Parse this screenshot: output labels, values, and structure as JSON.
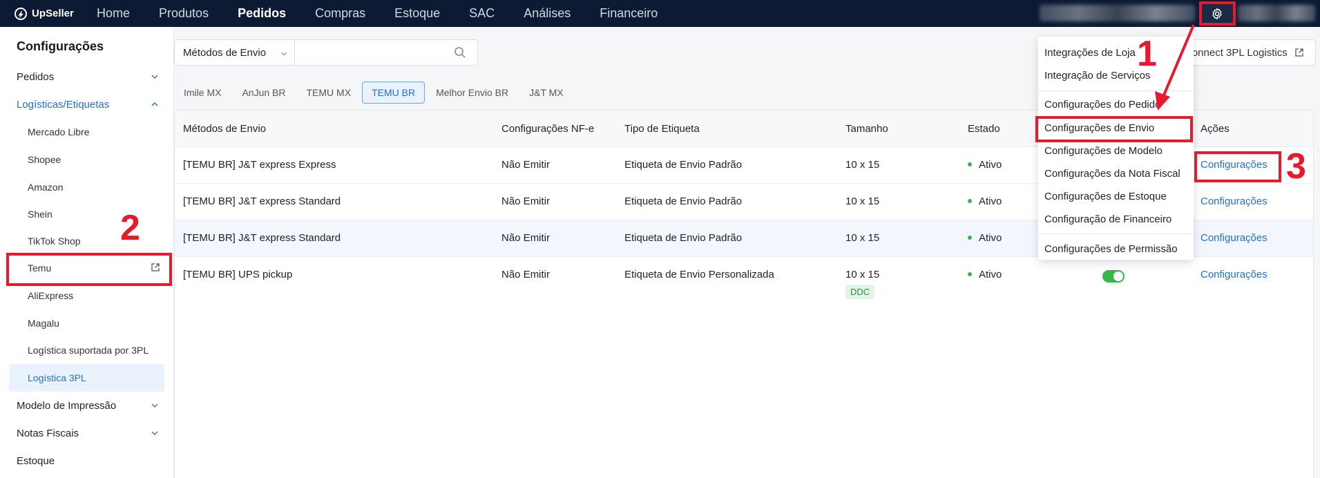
{
  "app": {
    "name": "UpSeller"
  },
  "nav": {
    "items": [
      "Home",
      "Produtos",
      "Pedidos",
      "Compras",
      "Estoque",
      "SAC",
      "Análises",
      "Financeiro"
    ],
    "active": "Pedidos"
  },
  "sidebar": {
    "title": "Configurações",
    "items": [
      {
        "label": "Pedidos"
      },
      {
        "label": "Logísticas/Etiquetas"
      },
      {
        "label": "Mercado Libre"
      },
      {
        "label": "Shopee"
      },
      {
        "label": "Amazon"
      },
      {
        "label": "Shein"
      },
      {
        "label": "TikTok Shop"
      },
      {
        "label": "Temu"
      },
      {
        "label": "AliExpress"
      },
      {
        "label": "Magalu"
      },
      {
        "label": "Logística suportada por 3PL"
      },
      {
        "label": "Logística 3PL"
      },
      {
        "label": "Modelo de Impressão"
      },
      {
        "label": "Notas Fiscais"
      },
      {
        "label": "Estoque"
      }
    ]
  },
  "filter": {
    "select_value": "Métodos de Envio",
    "search_placeholder": ""
  },
  "connect_button": {
    "label": "Connect 3PL Logistics"
  },
  "tabs": [
    "Imile MX",
    "AnJun BR",
    "TEMU MX",
    "TEMU BR",
    "Melhor Envio BR",
    "J&T MX"
  ],
  "active_tab": "TEMU BR",
  "table": {
    "columns": [
      "Métodos de Envio",
      "Configurações NF-e",
      "Tipo de Etiqueta",
      "Tamanho",
      "Estado",
      "Ações"
    ],
    "rows": [
      {
        "method": "[TEMU BR] J&T express Express",
        "nfe": "Não Emitir",
        "label_type": "Etiqueta de Envio Padrão",
        "size": "10 x 15",
        "status": "Ativo",
        "action": "Configurações"
      },
      {
        "method": "[TEMU BR] J&T express Standard",
        "nfe": "Não Emitir",
        "label_type": "Etiqueta de Envio Padrão",
        "size": "10 x 15",
        "status": "Ativo",
        "action": "Configurações"
      },
      {
        "method": "[TEMU BR] J&T express Standard",
        "nfe": "Não Emitir",
        "label_type": "Etiqueta de Envio Padrão",
        "size": "10 x 15",
        "status": "Ativo",
        "action": "Configurações"
      },
      {
        "method": "[TEMU BR] UPS pickup",
        "nfe": "Não Emitir",
        "label_type": "Etiqueta de Envio Personalizada",
        "size": "10 x 15",
        "badge": "DDC",
        "status": "Ativo",
        "action": "Configurações"
      }
    ]
  },
  "dropdown": {
    "items": [
      "Integrações de Loja",
      "Integração de Serviços",
      "Configurações do Pedido",
      "Configurações de Envio",
      "Configurações de Modelo",
      "Configurações da Nota Fiscal",
      "Configurações de Estoque",
      "Configuração de Financeiro",
      "Configurações de Permissão"
    ]
  },
  "annotations": {
    "step1": "1",
    "step2": "2",
    "step3": "3",
    "color": "#e8192c"
  },
  "colors": {
    "topbar": "#0c1b33",
    "accent": "#1f6fd1",
    "active_status": "#3ab54a"
  }
}
